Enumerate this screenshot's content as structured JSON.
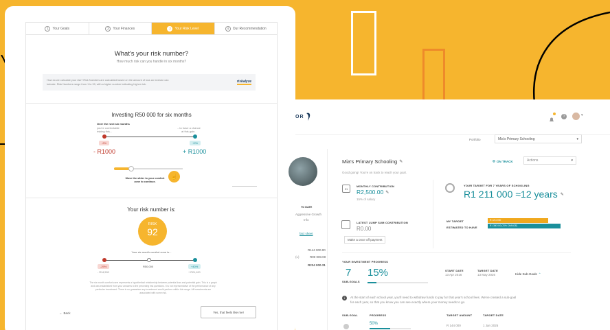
{
  "wizard": {
    "steps": [
      {
        "num": "1",
        "label": "Your Goals"
      },
      {
        "num": "2",
        "label": "Your Finances"
      },
      {
        "num": "3",
        "label": "Your Risk Level"
      },
      {
        "num": "4",
        "label": "Our Recommendation"
      }
    ],
    "title": "What's your risk number?",
    "subtitle": "How much risk can you handle in six months?",
    "info_text_1": "How do we calculate your risk? Risk Numbers are calculated based on the amount of loss an investor can",
    "info_text_2": "tolerate. Risk Numbers range from 1 to 99, with a higher number indicating higher risk.",
    "logo_text": "riskalyze",
    "investing_title": "Investing R50 000 for six months",
    "over_next": "Over the next six months",
    "comfortable_1": "you're comfortable",
    "comfortable_2": "risking this...",
    "chance_1": "...to have a chance",
    "chance_2": "at this gain.",
    "loss_pct": "-2%",
    "gain_pct": "+2%",
    "loss_amount": "- R1000",
    "gain_amount": "+ R1000",
    "slider_hint_1": "Move the slider to your comfort",
    "slider_hint_2": "zone to continue.",
    "slider_level": 0.25,
    "risk_heading": "Your risk number is:",
    "risk_label": "RISK",
    "risk_value": "92",
    "comfort_zone": "Your six month comfort zone is...",
    "zone_low_pct": "-29%",
    "zone_mid": "R50,000",
    "zone_high_pct": "+40%",
    "zone_low_amt": "- R14,500",
    "zone_high_amt": "+ R21,100",
    "disclaimer_1": "The six month comfort zone represents a hypothetical relationship between potential loss and potential gain. This is a graph",
    "disclaimer_2": "and was established from your answers to the preceding risk questions. It is not representative of the performance of any",
    "disclaimer_3": "particular investment. There is no guarantee any investment would perform within this range. All investments are",
    "disclaimer_4": "associated with some risk.",
    "back": "Back",
    "confirm": "Yes, that feels like me!"
  },
  "dashboard": {
    "logo_text": "OR",
    "portfolio_label": "Portfolio",
    "portfolio_value": "Mia's Primary Schooling",
    "goal_title": "Mia's Primary Schooling",
    "on_track": "ON TRACK",
    "actions": "Actions",
    "intro": "Good going! You're on track to reach your goal.",
    "monthly_label": "MONTHLY CONTRIBUTION",
    "monthly_value": "R2,500.00",
    "monthly_sub": "15% of salary",
    "target_label": "YOUR TARGET FOR 7 YEARS OF SCHOOLING",
    "target_value": "R1 211 000",
    "target_years": "≈12 years",
    "lump_label": "LATEST LUMP SUM CONTRIBUTION",
    "lump_value": "R0.00",
    "lump_button": "Make a once off payment",
    "my_target": "MY TARGET",
    "estimated": "ESTIMATED TO HAVE",
    "bar_target": "R1 211 000",
    "bar_estimated": "R1 380 000 (70% CHANCE)",
    "side_to_date": "TO DATE",
    "side_growth": "Aggressive Growth",
    "side_info": "Info",
    "side_fact": "fact sheet",
    "side_amt_1": "R144 000.00",
    "side_amt_2_label": "(L)",
    "side_amt_2": "R90 000.00",
    "side_amt_3": "R234 000.31",
    "progress_title": "YOUR INVESTMENT PROGRESS",
    "subgoals_count": "7",
    "subgoals_label": "SUB-GOALS",
    "progress_pct": "15%",
    "progress_fraction": 0.15,
    "start_label": "START DATE",
    "start_value": "13 Apr 2016",
    "target_date_label": "TARGET DATE",
    "target_date_value": "13 May 2026",
    "hide_subgoals": "Hide Sub-Goals",
    "notice_1": "At the start of each school year, you'll need to withdraw funds to pay for that year's school fees. We've created a sub-goal",
    "notice_2": "for each year, so that you know you can see exactly where your money needs to go.",
    "table_headers": [
      "SUB-GOAL",
      "PROGRESS",
      "TARGET AMOUNT",
      "TARGET DATE"
    ],
    "row_pct": "50%",
    "row_amount": "R 144 000",
    "row_date": "1 Jan 2025"
  },
  "colors": {
    "background": "#F6B52E",
    "accent": "#F6B52E",
    "teal": "#1a8f9b",
    "loss": "#c0392b",
    "progress_orange": "#F0A81E"
  }
}
